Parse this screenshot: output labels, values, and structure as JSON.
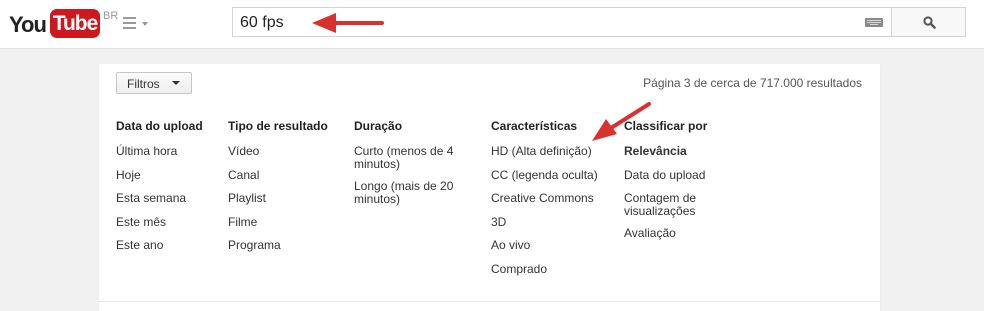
{
  "header": {
    "logo_you": "You",
    "logo_tube": "Tube",
    "country_code": "BR",
    "guide_icon": "hamburger-menu-icon",
    "search": {
      "value": "60 fps",
      "keyboard_icon": "keyboard-icon",
      "button_icon": "search-icon"
    }
  },
  "filters": {
    "button_label": "Filtros",
    "result_count": "Página 3 de cerca de 717.000 resultados",
    "columns": [
      {
        "title": "Data do upload",
        "items": [
          "Última hora",
          "Hoje",
          "Esta semana",
          "Este mês",
          "Este ano"
        ]
      },
      {
        "title": "Tipo de resultado",
        "items": [
          "Vídeo",
          "Canal",
          "Playlist",
          "Filme",
          "Programa"
        ]
      },
      {
        "title": "Duração",
        "items": [
          "Curto (menos de 4 minutos)",
          "Longo (mais de 20 minutos)"
        ]
      },
      {
        "title": "Características",
        "items": [
          "HD (Alta definição)",
          "CC (legenda oculta)",
          "Creative Commons",
          "3D",
          "Ao vivo",
          "Comprado"
        ]
      },
      {
        "title": "Classificar por",
        "items": [
          "Relevância",
          "Data do upload",
          "Contagem de visualizações",
          "Avaliação"
        ]
      }
    ]
  },
  "colors": {
    "brand_red": "#cc181e",
    "annotation_red": "#d8322e",
    "background": "#f1f1f1"
  }
}
